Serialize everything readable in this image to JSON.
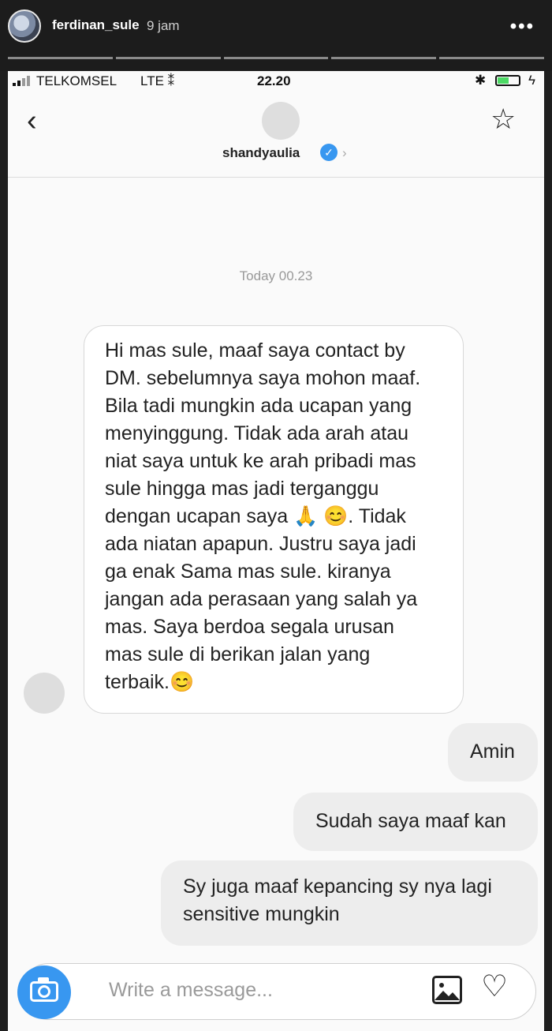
{
  "story": {
    "username": "ferdinan_sule",
    "time": "9 jam",
    "more_icon": "more-horizontal-icon",
    "more_glyph": "•••"
  },
  "statusbar": {
    "carrier": "TELKOMSEL",
    "network": "LTE ⁑",
    "time": "22.20",
    "bluetooth_glyph": "✱",
    "charge_glyph": "ϟ",
    "battery_level": 0.55
  },
  "thread": {
    "back_glyph": "‹",
    "username": "shandyaulia",
    "verified_glyph": "✓",
    "chevron_glyph": "›",
    "star_glyph": "☆",
    "timestamp": "Today 00.23"
  },
  "messages": {
    "received": "Hi mas sule, maaf saya contact by\nDM. sebelumnya saya mohon maaf.\nBila tadi mungkin ada ucapan yang\nmenyinggung. Tidak ada arah atau\nniat saya untuk ke arah pribadi mas\nsule hingga mas jadi terganggu\ndengan ucapan saya 🙏 😊. Tidak\nada niatan apapun. Justru saya jadi\nga enak Sama mas sule. kiranya\njangan ada perasaan yang salah ya\nmas. Saya  berdoa segala urusan\nmas sule di berikan jalan yang\nterbaik.😊",
    "sent": [
      "Amin",
      "Sudah saya maaf kan",
      "Sy juga maaf kepancing sy nya lagi\nsensitive mungkin"
    ]
  },
  "composer": {
    "placeholder": "Write a message...",
    "heart_glyph": "♡"
  },
  "colors": {
    "accent": "#3897f0",
    "battery": "#4cd964"
  }
}
